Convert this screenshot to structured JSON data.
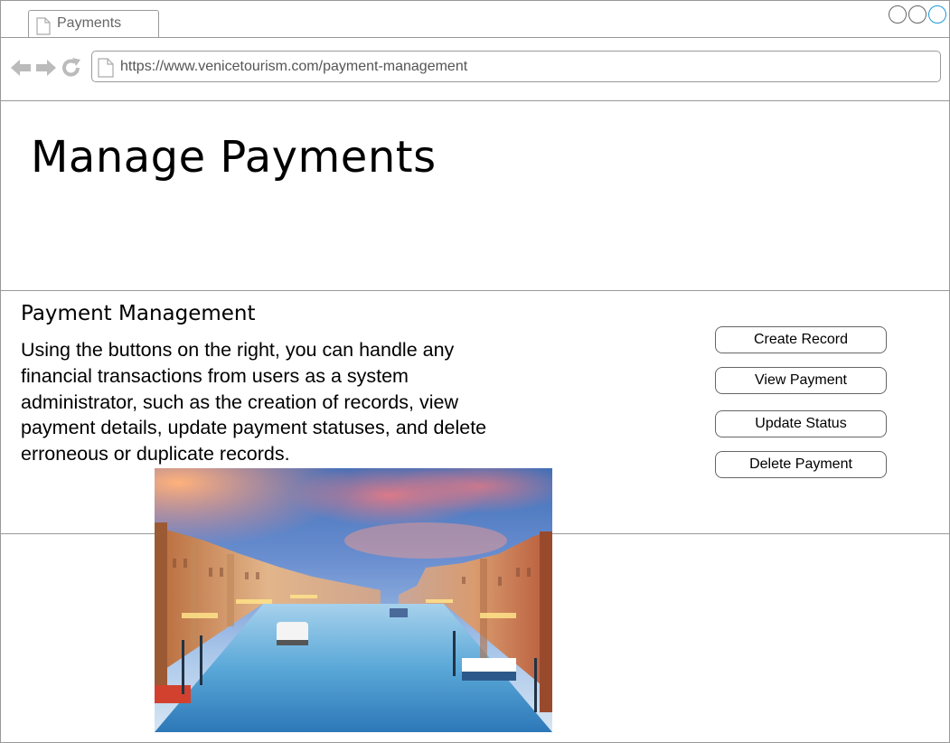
{
  "browser": {
    "tab_title": "Payments",
    "url": "https://www.venicetourism.com/payment-management"
  },
  "page": {
    "title": "Manage Payments",
    "section_heading": "Payment Management",
    "description": "Using the buttons on the right, you can handle any financial transactions from users as a system administrator, such as the creation of records, view payment details, update payment statuses, and delete erroneous or duplicate records."
  },
  "actions": {
    "create_label": "Create Record",
    "view_label": "View Payment",
    "update_label": "Update Status",
    "delete_label": "Delete Payment"
  },
  "image": {
    "subject": "venice-grand-canal-photo"
  },
  "colors": {
    "border": "#999999",
    "maximize_accent": "#1d9ad6",
    "icon_gray": "#bbbbbb"
  }
}
